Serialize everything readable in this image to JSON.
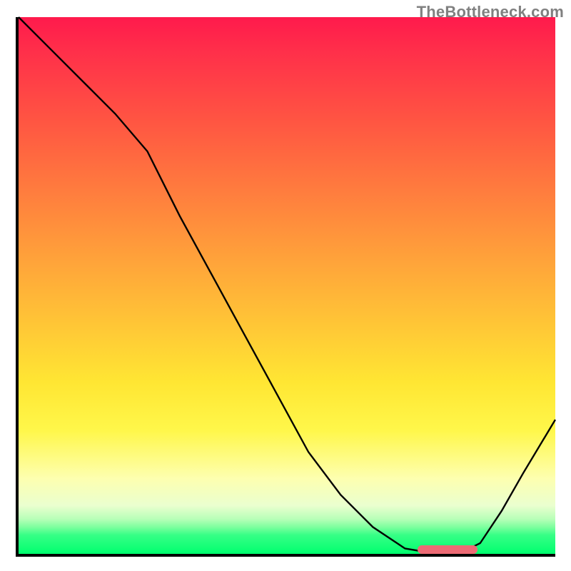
{
  "attribution": "TheBottleneck.com",
  "colors": {
    "axis": "#000000",
    "curve": "#000000",
    "optimum_bar": "#ed6b75",
    "gradient_top": "#ff1a4c",
    "gradient_bottom": "#00ff6e"
  },
  "chart_data": {
    "type": "line",
    "title": "",
    "xlabel": "",
    "ylabel": "",
    "xlim": [
      0,
      100
    ],
    "ylim": [
      0,
      100
    ],
    "grid": false,
    "series": [
      {
        "name": "bottleneck-curve",
        "x": [
          0,
          6,
          12,
          18,
          24,
          30,
          36,
          42,
          48,
          54,
          60,
          66,
          72,
          78,
          82,
          86,
          90,
          94,
          100
        ],
        "values": [
          100,
          94,
          88,
          82,
          75,
          63,
          52,
          41,
          30,
          19,
          11,
          5,
          1,
          0,
          0,
          2,
          8,
          15,
          25
        ]
      }
    ],
    "annotations": [
      {
        "name": "optimum-range",
        "x_start": 74,
        "x_end": 85,
        "y": 0.8
      }
    ]
  }
}
